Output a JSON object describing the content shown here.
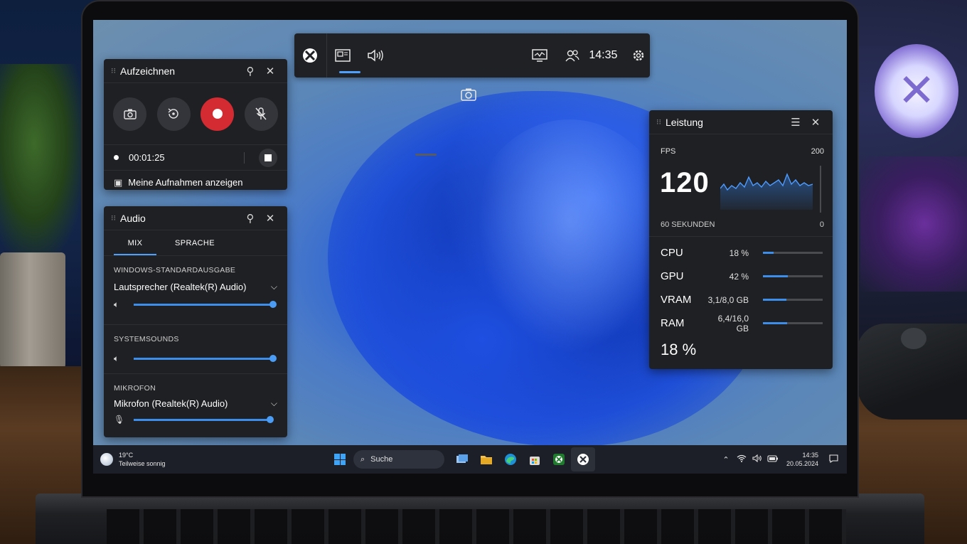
{
  "gamebar": {
    "clock": "14:35",
    "icons": [
      "xbox-icon",
      "widget-menu-icon",
      "audio-icon",
      "capture-icon",
      "performance-icon",
      "social-icon",
      "settings-icon"
    ]
  },
  "capture": {
    "title": "Aufzeichnen",
    "elapsed": "00:01:25",
    "show_recordings": "Meine Aufnahmen anzeigen",
    "record_color": "#d42b33"
  },
  "audio": {
    "title": "Audio",
    "tabs": [
      "MIX",
      "SPRACHE"
    ],
    "sections": [
      {
        "label": "WINDOWS-STANDARDAUSGABE",
        "device": "Lautsprecher (Realtek(R) Audio)",
        "level": 1.0
      },
      {
        "label": "SYSTEMSOUNDS",
        "device": "",
        "level": 1.0
      },
      {
        "label": "MIKROFON",
        "device": "Mikrofon (Realtek(R) Audio)",
        "level": 1.0
      }
    ]
  },
  "performance": {
    "title": "Leistung",
    "fps_label": "FPS",
    "fps_value": "120",
    "fps_max": "200",
    "fps_min": "0",
    "window_label": "60 SEKUNDEN",
    "metrics": [
      {
        "name": "CPU",
        "value": "18 %",
        "level": 0.18
      },
      {
        "name": "GPU",
        "value": "42 %",
        "level": 0.42
      },
      {
        "name": "VRAM",
        "value": "3,1/8,0 GB",
        "level": 0.39
      },
      {
        "name": "RAM",
        "value": "6,4/16,0 GB",
        "level": 0.4
      }
    ],
    "summary": "18 %",
    "accent": "#3d8eea"
  },
  "taskbar": {
    "temperature": "19°C",
    "weather": "Teilweise sonnig",
    "search_placeholder": "Suche",
    "time": "14:35",
    "date": "20.05.2024"
  }
}
